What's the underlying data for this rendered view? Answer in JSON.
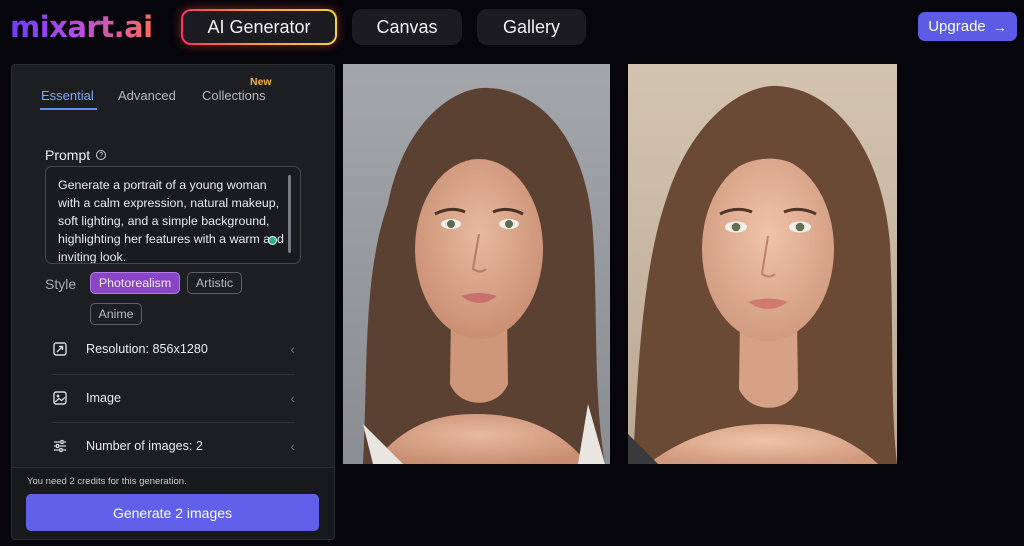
{
  "header": {
    "logo": "mixart.ai",
    "nav": [
      {
        "label": "AI Generator",
        "active": true
      },
      {
        "label": "Canvas"
      },
      {
        "label": "Gallery"
      }
    ],
    "upgrade_label": "Upgrade",
    "upgrade_icon": "arrow-right-icon"
  },
  "panel": {
    "tabs": [
      {
        "label": "Essential",
        "active": true
      },
      {
        "label": "Advanced"
      },
      {
        "label": "Collections",
        "badge": "New"
      }
    ],
    "prompt_label": "Prompt",
    "prompt_text": "Generate a portrait of a young woman with a calm expression, natural makeup, soft lighting, and a simple background, highlighting her features with a warm and inviting look.",
    "style_label": "Style",
    "styles": [
      {
        "label": "Photorealism",
        "selected": true
      },
      {
        "label": "Artistic"
      },
      {
        "label": "Anime"
      }
    ],
    "settings": [
      {
        "label": "Resolution: 856x1280",
        "icon": "resize-icon"
      },
      {
        "label": "Image",
        "icon": "image-icon"
      },
      {
        "label": "Number of images: 2",
        "icon": "sliders-icon"
      }
    ],
    "credits_note": "You need 2 credits for this generation.",
    "generate_label": "Generate 2 images"
  },
  "colors": {
    "accent": "#6160ea",
    "selected_style": "#8a45c6",
    "active_tab": "#79a6ff",
    "new_badge": "#f2b23a"
  }
}
